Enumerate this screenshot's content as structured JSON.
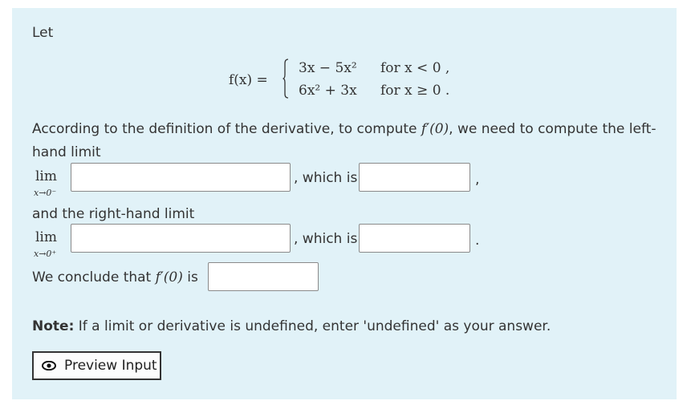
{
  "intro": "Let",
  "function_def": {
    "lhs": "f(x) =",
    "piece1_expr": "3x − 5x²",
    "piece1_cond": "for x < 0 ,",
    "piece2_expr": "6x² + 3x",
    "piece2_cond": "for x ≥ 0 ."
  },
  "instruction": {
    "line1_prefix": "According to the definition of the derivative, to compute",
    "fprime": "f′(0)",
    "line1_suffix": ", we need to compute the left-",
    "line2": "hand limit"
  },
  "left_limit": {
    "lim": "lim",
    "subscript": "x→0⁻",
    "which_is": ", which is",
    "trailing": ","
  },
  "right_limit_intro": "and the right-hand limit",
  "right_limit": {
    "lim": "lim",
    "subscript": "x→0⁺",
    "which_is": ", which is",
    "trailing": "."
  },
  "conclusion": {
    "prefix": "We conclude that",
    "fprime": "f′(0)",
    "suffix": "is"
  },
  "note": {
    "label": "Note:",
    "text": "If a limit or derivative is undefined, enter 'undefined' as your answer."
  },
  "inputs": {
    "left_limit_expr": "",
    "left_limit_value": "",
    "right_limit_expr": "",
    "right_limit_value": "",
    "derivative_value": ""
  },
  "preview_button": {
    "label": "Preview Input",
    "icon": "eye-icon"
  }
}
